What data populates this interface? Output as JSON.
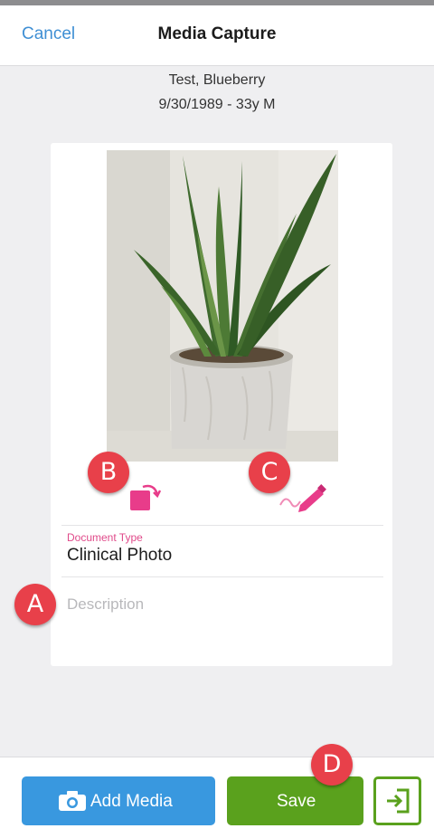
{
  "nav": {
    "cancel_label": "Cancel",
    "title": "Media Capture"
  },
  "patient": {
    "name": "Test, Blueberry",
    "details": "9/30/1989 - 33y M"
  },
  "form": {
    "document_type_label": "Document Type",
    "document_type_value": "Clinical Photo",
    "description_placeholder": "Description"
  },
  "tools": {
    "rotate_icon": "rotate-icon",
    "annotate_icon": "annotate-pen-icon"
  },
  "callouts": {
    "a": "A",
    "b": "B",
    "c": "C",
    "d": "D"
  },
  "toolbar": {
    "add_media_label": "Add Media",
    "save_label": "Save",
    "exit_icon": "exit-icon"
  },
  "colors": {
    "accent_blue": "#3998df",
    "save_green": "#5aa11d",
    "link_blue": "#3f8fd4",
    "pink": "#e04a8a",
    "callout_red": "#e8404a"
  }
}
